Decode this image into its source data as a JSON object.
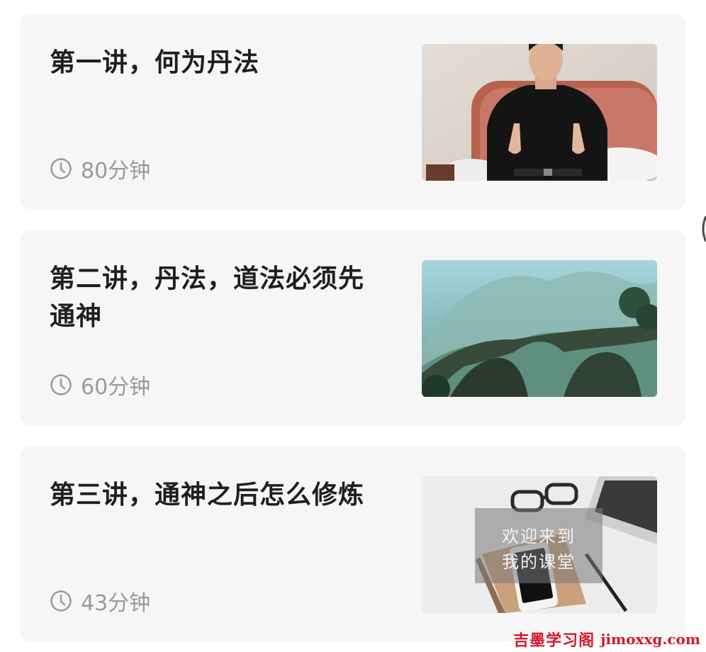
{
  "lessons": [
    {
      "title": "第一讲，何为丹法",
      "duration": "80分钟",
      "thumbnail": "person-meditating-thumbnail"
    },
    {
      "title": "第二讲，丹法，道法必须先通神",
      "duration": "60分钟",
      "thumbnail": "stone-arch-landscape-thumbnail"
    },
    {
      "title": "第三讲，通神之后怎么修炼",
      "duration": "43分钟",
      "thumbnail": "desk-notebook-thumbnail",
      "overlay_line1": "欢迎来到",
      "overlay_line2": "我的课堂"
    }
  ],
  "icons": {
    "duration": "clock-icon"
  },
  "watermark": {
    "chinese": "吉墨学习阁",
    "latin": "jimoxxg.com"
  },
  "colors": {
    "card_background": "#f6f6f7",
    "title_text": "#1f1f1f",
    "muted_text": "#9a9a9a",
    "watermark": "#d21a2a"
  }
}
